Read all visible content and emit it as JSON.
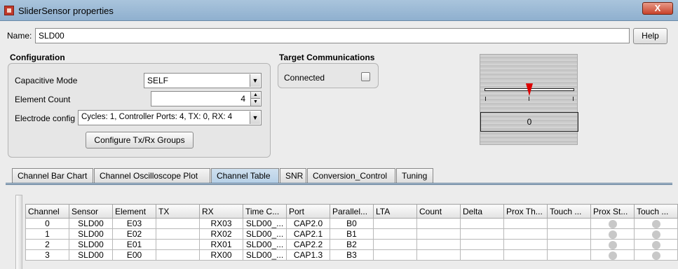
{
  "window": {
    "title": "SliderSensor properties",
    "close_label": "X"
  },
  "name_row": {
    "label": "Name:",
    "value": "SLD00",
    "help_label": "Help"
  },
  "configuration": {
    "title": "Configuration",
    "capacitive_mode": {
      "label": "Capacitive Mode",
      "value": "SELF"
    },
    "element_count": {
      "label": "Element Count",
      "value": "4"
    },
    "electrode_config": {
      "label": "Electrode config",
      "value": "Cycles:  1, Controller Ports:  4, TX:  0, RX:  4"
    },
    "configure_button": "Configure Tx/Rx Groups"
  },
  "target_communications": {
    "title": "Target Communications",
    "connected_label": "Connected",
    "connected": false
  },
  "slider": {
    "value": "0",
    "position": 0.5
  },
  "tabs": [
    "Channel Bar Chart",
    "Channel Oscilloscope Plot",
    "Channel Table",
    "SNR",
    "Conversion_Control",
    "Tuning"
  ],
  "active_tab": "Channel Table",
  "table": {
    "headers": [
      "Channel",
      "Sensor",
      "Element",
      "TX",
      "RX",
      "Time C...",
      "Port",
      "Parallel...",
      "LTA",
      "Count",
      "Delta",
      "Prox Th...",
      "Touch ...",
      "Prox St...",
      "Touch ..."
    ],
    "rows": [
      [
        "0",
        "SLD00",
        "E03",
        "",
        "RX03",
        "SLD00_...",
        "CAP2.0",
        "B0",
        "",
        "",
        "",
        "",
        "",
        "",
        ""
      ],
      [
        "1",
        "SLD00",
        "E02",
        "",
        "RX02",
        "SLD00_...",
        "CAP2.1",
        "B1",
        "",
        "",
        "",
        "",
        "",
        "",
        ""
      ],
      [
        "2",
        "SLD00",
        "E01",
        "",
        "RX01",
        "SLD00_...",
        "CAP2.2",
        "B2",
        "",
        "",
        "",
        "",
        "",
        "",
        ""
      ],
      [
        "3",
        "SLD00",
        "E00",
        "",
        "RX00",
        "SLD00_...",
        "CAP1.3",
        "B3",
        "",
        "",
        "",
        "",
        "",
        "",
        ""
      ]
    ],
    "status_columns": [
      "Prox St...",
      "Touch ..."
    ]
  }
}
